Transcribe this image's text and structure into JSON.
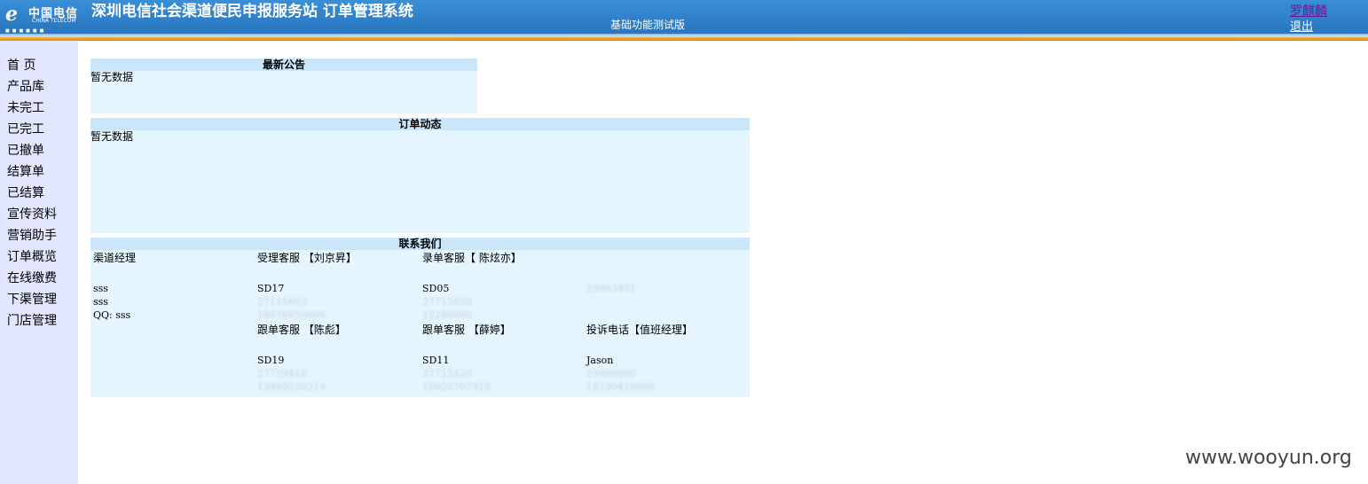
{
  "header": {
    "logo_cn": "中国电信",
    "logo_en": "CHINA TELECOM",
    "title": "深圳电信社会渠道便民申报服务站  订单管理系统",
    "subtitle": "基础功能测试版",
    "user": "罗麒麟",
    "logout": "退出"
  },
  "sidebar": {
    "items": [
      {
        "label": "首  页"
      },
      {
        "label": "产品库"
      },
      {
        "label": "未完工"
      },
      {
        "label": "已完工"
      },
      {
        "label": "已撤单"
      },
      {
        "label": "结算单"
      },
      {
        "label": "已结算"
      },
      {
        "label": "宣传资料"
      },
      {
        "label": "营销助手"
      },
      {
        "label": "订单概览"
      },
      {
        "label": "在线缴费"
      },
      {
        "label": "下渠管理"
      },
      {
        "label": "门店管理"
      }
    ]
  },
  "announcements": {
    "title": "最新公告",
    "empty": "暂无数据"
  },
  "order_updates": {
    "title": "订单动态",
    "empty": "暂无数据"
  },
  "contact": {
    "title": "联系我们",
    "channel_manager": {
      "label": "渠道经理",
      "l1": "sss",
      "l2": "sss",
      "l3": "QQ: sss"
    },
    "acceptance": {
      "label": "受理客服 【刘京昇】",
      "l1": "SD17",
      "l2": "27115663",
      "l3": "18676650606"
    },
    "entry": {
      "label": "录单客服【 陈炫亦】",
      "l1": "SD05",
      "l2": "27715850",
      "l3": "15280000"
    },
    "entry_extra": {
      "l1": "29963401"
    },
    "follow1": {
      "label": "跟单客服 【陈彪】",
      "l1": "SD19",
      "l2": "27759410",
      "l3": "13469550219"
    },
    "follow2": {
      "label": "跟单客服 【薛婷】",
      "l1": "SD11",
      "l2": "27715420",
      "l3": "18920707915"
    },
    "complaint": {
      "label": "投诉电话【值班经理】",
      "l1": "Jason",
      "l2": "29900000",
      "l3": "18130418888"
    }
  },
  "watermark": "www.wooyun.org"
}
